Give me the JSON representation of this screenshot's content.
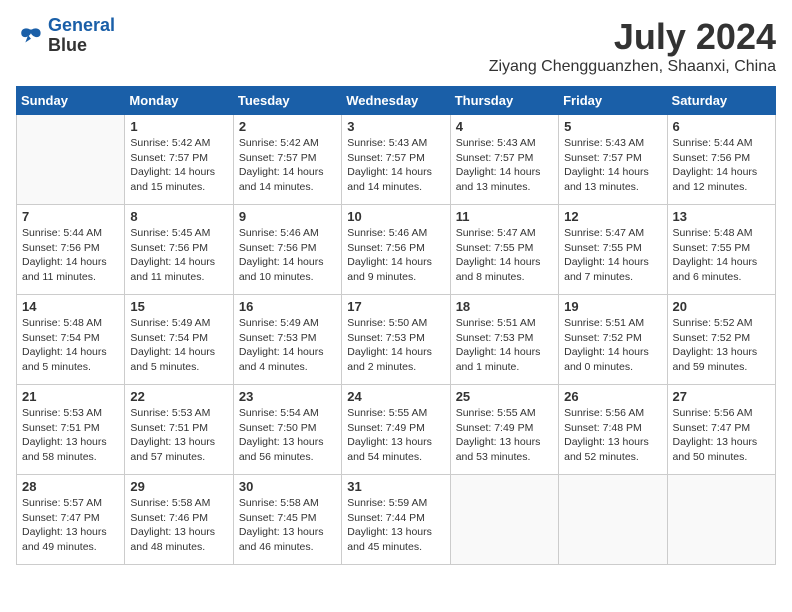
{
  "header": {
    "logo_line1": "General",
    "logo_line2": "Blue",
    "month": "July 2024",
    "location": "Ziyang Chengguanzhen, Shaanxi, China"
  },
  "days_of_week": [
    "Sunday",
    "Monday",
    "Tuesday",
    "Wednesday",
    "Thursday",
    "Friday",
    "Saturday"
  ],
  "weeks": [
    [
      {
        "day": "",
        "sunrise": "",
        "sunset": "",
        "daylight": ""
      },
      {
        "day": "1",
        "sunrise": "Sunrise: 5:42 AM",
        "sunset": "Sunset: 7:57 PM",
        "daylight": "Daylight: 14 hours and 15 minutes."
      },
      {
        "day": "2",
        "sunrise": "Sunrise: 5:42 AM",
        "sunset": "Sunset: 7:57 PM",
        "daylight": "Daylight: 14 hours and 14 minutes."
      },
      {
        "day": "3",
        "sunrise": "Sunrise: 5:43 AM",
        "sunset": "Sunset: 7:57 PM",
        "daylight": "Daylight: 14 hours and 14 minutes."
      },
      {
        "day": "4",
        "sunrise": "Sunrise: 5:43 AM",
        "sunset": "Sunset: 7:57 PM",
        "daylight": "Daylight: 14 hours and 13 minutes."
      },
      {
        "day": "5",
        "sunrise": "Sunrise: 5:43 AM",
        "sunset": "Sunset: 7:57 PM",
        "daylight": "Daylight: 14 hours and 13 minutes."
      },
      {
        "day": "6",
        "sunrise": "Sunrise: 5:44 AM",
        "sunset": "Sunset: 7:56 PM",
        "daylight": "Daylight: 14 hours and 12 minutes."
      }
    ],
    [
      {
        "day": "7",
        "sunrise": "Sunrise: 5:44 AM",
        "sunset": "Sunset: 7:56 PM",
        "daylight": "Daylight: 14 hours and 11 minutes."
      },
      {
        "day": "8",
        "sunrise": "Sunrise: 5:45 AM",
        "sunset": "Sunset: 7:56 PM",
        "daylight": "Daylight: 14 hours and 11 minutes."
      },
      {
        "day": "9",
        "sunrise": "Sunrise: 5:46 AM",
        "sunset": "Sunset: 7:56 PM",
        "daylight": "Daylight: 14 hours and 10 minutes."
      },
      {
        "day": "10",
        "sunrise": "Sunrise: 5:46 AM",
        "sunset": "Sunset: 7:56 PM",
        "daylight": "Daylight: 14 hours and 9 minutes."
      },
      {
        "day": "11",
        "sunrise": "Sunrise: 5:47 AM",
        "sunset": "Sunset: 7:55 PM",
        "daylight": "Daylight: 14 hours and 8 minutes."
      },
      {
        "day": "12",
        "sunrise": "Sunrise: 5:47 AM",
        "sunset": "Sunset: 7:55 PM",
        "daylight": "Daylight: 14 hours and 7 minutes."
      },
      {
        "day": "13",
        "sunrise": "Sunrise: 5:48 AM",
        "sunset": "Sunset: 7:55 PM",
        "daylight": "Daylight: 14 hours and 6 minutes."
      }
    ],
    [
      {
        "day": "14",
        "sunrise": "Sunrise: 5:48 AM",
        "sunset": "Sunset: 7:54 PM",
        "daylight": "Daylight: 14 hours and 5 minutes."
      },
      {
        "day": "15",
        "sunrise": "Sunrise: 5:49 AM",
        "sunset": "Sunset: 7:54 PM",
        "daylight": "Daylight: 14 hours and 5 minutes."
      },
      {
        "day": "16",
        "sunrise": "Sunrise: 5:49 AM",
        "sunset": "Sunset: 7:53 PM",
        "daylight": "Daylight: 14 hours and 4 minutes."
      },
      {
        "day": "17",
        "sunrise": "Sunrise: 5:50 AM",
        "sunset": "Sunset: 7:53 PM",
        "daylight": "Daylight: 14 hours and 2 minutes."
      },
      {
        "day": "18",
        "sunrise": "Sunrise: 5:51 AM",
        "sunset": "Sunset: 7:53 PM",
        "daylight": "Daylight: 14 hours and 1 minute."
      },
      {
        "day": "19",
        "sunrise": "Sunrise: 5:51 AM",
        "sunset": "Sunset: 7:52 PM",
        "daylight": "Daylight: 14 hours and 0 minutes."
      },
      {
        "day": "20",
        "sunrise": "Sunrise: 5:52 AM",
        "sunset": "Sunset: 7:52 PM",
        "daylight": "Daylight: 13 hours and 59 minutes."
      }
    ],
    [
      {
        "day": "21",
        "sunrise": "Sunrise: 5:53 AM",
        "sunset": "Sunset: 7:51 PM",
        "daylight": "Daylight: 13 hours and 58 minutes."
      },
      {
        "day": "22",
        "sunrise": "Sunrise: 5:53 AM",
        "sunset": "Sunset: 7:51 PM",
        "daylight": "Daylight: 13 hours and 57 minutes."
      },
      {
        "day": "23",
        "sunrise": "Sunrise: 5:54 AM",
        "sunset": "Sunset: 7:50 PM",
        "daylight": "Daylight: 13 hours and 56 minutes."
      },
      {
        "day": "24",
        "sunrise": "Sunrise: 5:55 AM",
        "sunset": "Sunset: 7:49 PM",
        "daylight": "Daylight: 13 hours and 54 minutes."
      },
      {
        "day": "25",
        "sunrise": "Sunrise: 5:55 AM",
        "sunset": "Sunset: 7:49 PM",
        "daylight": "Daylight: 13 hours and 53 minutes."
      },
      {
        "day": "26",
        "sunrise": "Sunrise: 5:56 AM",
        "sunset": "Sunset: 7:48 PM",
        "daylight": "Daylight: 13 hours and 52 minutes."
      },
      {
        "day": "27",
        "sunrise": "Sunrise: 5:56 AM",
        "sunset": "Sunset: 7:47 PM",
        "daylight": "Daylight: 13 hours and 50 minutes."
      }
    ],
    [
      {
        "day": "28",
        "sunrise": "Sunrise: 5:57 AM",
        "sunset": "Sunset: 7:47 PM",
        "daylight": "Daylight: 13 hours and 49 minutes."
      },
      {
        "day": "29",
        "sunrise": "Sunrise: 5:58 AM",
        "sunset": "Sunset: 7:46 PM",
        "daylight": "Daylight: 13 hours and 48 minutes."
      },
      {
        "day": "30",
        "sunrise": "Sunrise: 5:58 AM",
        "sunset": "Sunset: 7:45 PM",
        "daylight": "Daylight: 13 hours and 46 minutes."
      },
      {
        "day": "31",
        "sunrise": "Sunrise: 5:59 AM",
        "sunset": "Sunset: 7:44 PM",
        "daylight": "Daylight: 13 hours and 45 minutes."
      },
      {
        "day": "",
        "sunrise": "",
        "sunset": "",
        "daylight": ""
      },
      {
        "day": "",
        "sunrise": "",
        "sunset": "",
        "daylight": ""
      },
      {
        "day": "",
        "sunrise": "",
        "sunset": "",
        "daylight": ""
      }
    ]
  ]
}
